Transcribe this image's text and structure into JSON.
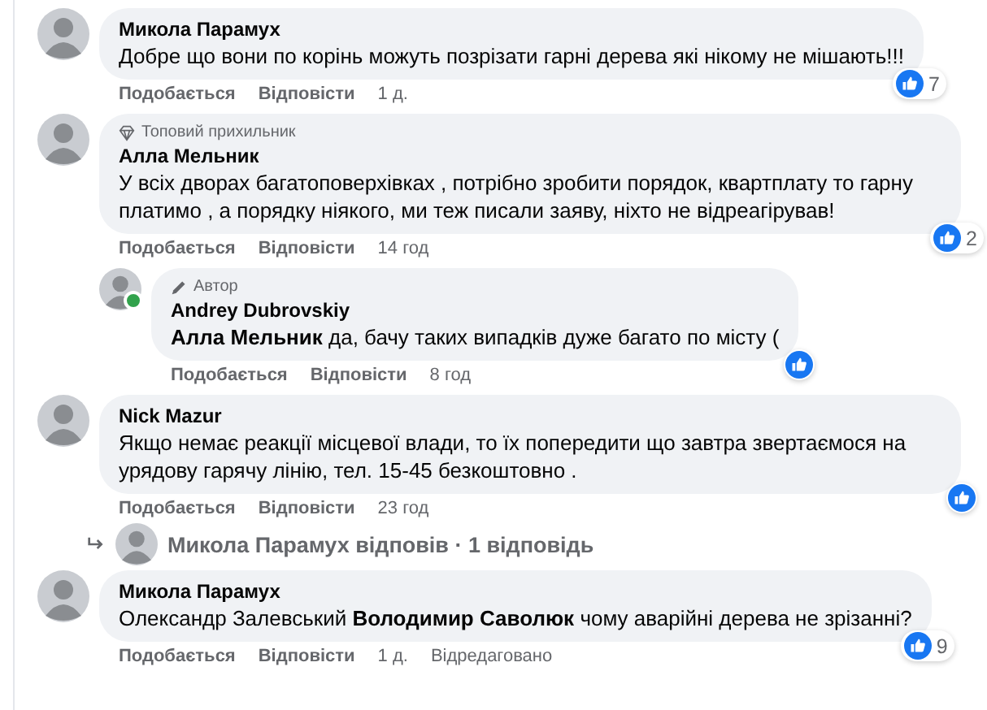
{
  "comments": [
    {
      "author": "Микола Парамух",
      "online": false,
      "text": "Добре що вони по корінь можуть позрізати гарні дерева які нікому не мішають!!!",
      "actions": {
        "like": "Подобається",
        "reply": "Відповісти",
        "time": "1 д."
      },
      "reactions": {
        "kind": "like",
        "count": "7"
      }
    },
    {
      "author": "Алла Мельник",
      "online": false,
      "badge": {
        "kind": "top-fan",
        "label": "Топовий прихильник"
      },
      "text": "У всіх дворах багатоповерхівках , потрібно зробити порядок, квартплату то гарну платимо , а порядку ніякого, ми теж писали заяву, ніхто не відреагірував!",
      "actions": {
        "like": "Подобається",
        "reply": "Відповісти",
        "time": "14 год"
      },
      "reactions": {
        "kind": "like",
        "count": "2"
      },
      "children": [
        {
          "author": "Andrey Dubrovskiy",
          "online": true,
          "badge": {
            "kind": "author",
            "label": "Автор"
          },
          "text": "**Алла Мельник** да, бачу таких випадків дуже багато по місту (",
          "actions": {
            "like": "Подобається",
            "reply": "Відповісти",
            "time": "8 год"
          },
          "reactions": {
            "kind": "like"
          }
        }
      ]
    },
    {
      "author": "Nick Mazur",
      "online": false,
      "text": "Якщо немає реакції місцевої влади, то їх попередити що завтра звертаємося на урядову гарячу лінію, тел. 15-45 безкоштовно .",
      "actions": {
        "like": "Подобається",
        "reply": "Відповісти",
        "time": "23 год"
      },
      "reactions": {
        "kind": "like"
      },
      "replies_summary": "Микола Парамух відповів · 1 відповідь"
    },
    {
      "author": "Микола Парамух",
      "online": false,
      "text": "Олександр Залевський **Володимир Саволюк** чому аварійні дерева не зрізанні?",
      "actions": {
        "like": "Подобається",
        "reply": "Відповісти",
        "time": "1 д.",
        "edited": "Відредаговано"
      },
      "reactions": {
        "kind": "like",
        "count": "9"
      }
    }
  ]
}
